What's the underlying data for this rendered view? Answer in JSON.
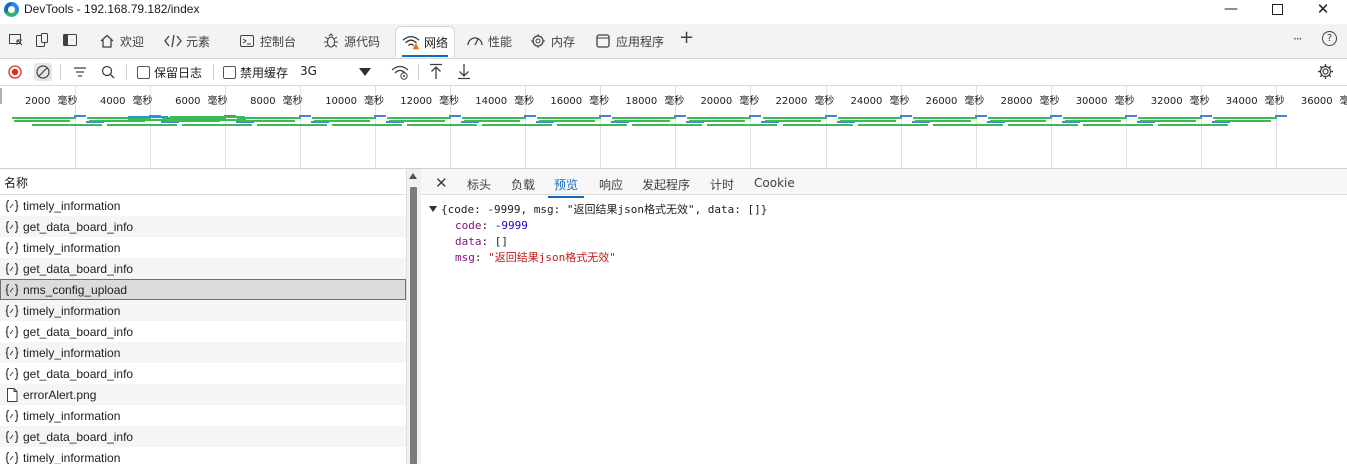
{
  "window": {
    "title": "DevTools - 192.168.79.182/index",
    "min": "—",
    "close": "✕"
  },
  "tabs": [
    {
      "label": "欢迎",
      "icon": "home-icon"
    },
    {
      "label": "元素",
      "icon": "code-icon"
    },
    {
      "label": "控制台",
      "icon": "console-icon"
    },
    {
      "label": "源代码",
      "icon": "bug-icon"
    },
    {
      "label": "网络",
      "icon": "wifi-warning-icon",
      "active": true
    },
    {
      "label": "性能",
      "icon": "gauge-icon"
    },
    {
      "label": "内存",
      "icon": "memory-icon"
    },
    {
      "label": "应用程序",
      "icon": "app-icon"
    }
  ],
  "tab_add": "+",
  "tab_more": "···",
  "tab_help": "?",
  "toolbar": {
    "preserve_log": "保留日志",
    "disable_cache": "禁用缓存",
    "throttle": "3G"
  },
  "overview": {
    "unit": "毫秒",
    "ticks": [
      "2000",
      "4000",
      "6000",
      "8000",
      "10000",
      "12000",
      "14000",
      "16000",
      "18000",
      "20000",
      "22000",
      "24000",
      "26000",
      "28000",
      "30000",
      "32000",
      "34000",
      "36000"
    ]
  },
  "request_list": {
    "header": "名称",
    "rows": [
      {
        "name": "timely_information",
        "type": "xhr"
      },
      {
        "name": "get_data_board_info",
        "type": "xhr"
      },
      {
        "name": "timely_information",
        "type": "xhr"
      },
      {
        "name": "get_data_board_info",
        "type": "xhr"
      },
      {
        "name": "nms_config_upload",
        "type": "xhr",
        "selected": true
      },
      {
        "name": "timely_information",
        "type": "xhr"
      },
      {
        "name": "get_data_board_info",
        "type": "xhr"
      },
      {
        "name": "timely_information",
        "type": "xhr"
      },
      {
        "name": "get_data_board_info",
        "type": "xhr"
      },
      {
        "name": "errorAlert.png",
        "type": "file"
      },
      {
        "name": "timely_information",
        "type": "xhr"
      },
      {
        "name": "get_data_board_info",
        "type": "xhr"
      },
      {
        "name": "timely_information",
        "type": "xhr"
      }
    ]
  },
  "detail": {
    "close": "✕",
    "tabs": [
      "标头",
      "负载",
      "预览",
      "响应",
      "发起程序",
      "计时",
      "Cookie"
    ],
    "active_tab": "预览",
    "summary": "{code: -9999, msg: \"返回结果json格式无效\", data: []}",
    "fields": [
      {
        "key": "code",
        "value": "-9999",
        "kind": "num"
      },
      {
        "key": "data",
        "value": "[]",
        "kind": "plain"
      },
      {
        "key": "msg",
        "value": "\"返回结果json格式无效\"",
        "kind": "str"
      }
    ]
  },
  "colors": {
    "accent": "#0f6cbd",
    "record": "#d93025",
    "bar_green": "#3cba54",
    "bar_blue": "#4a7fd8"
  }
}
